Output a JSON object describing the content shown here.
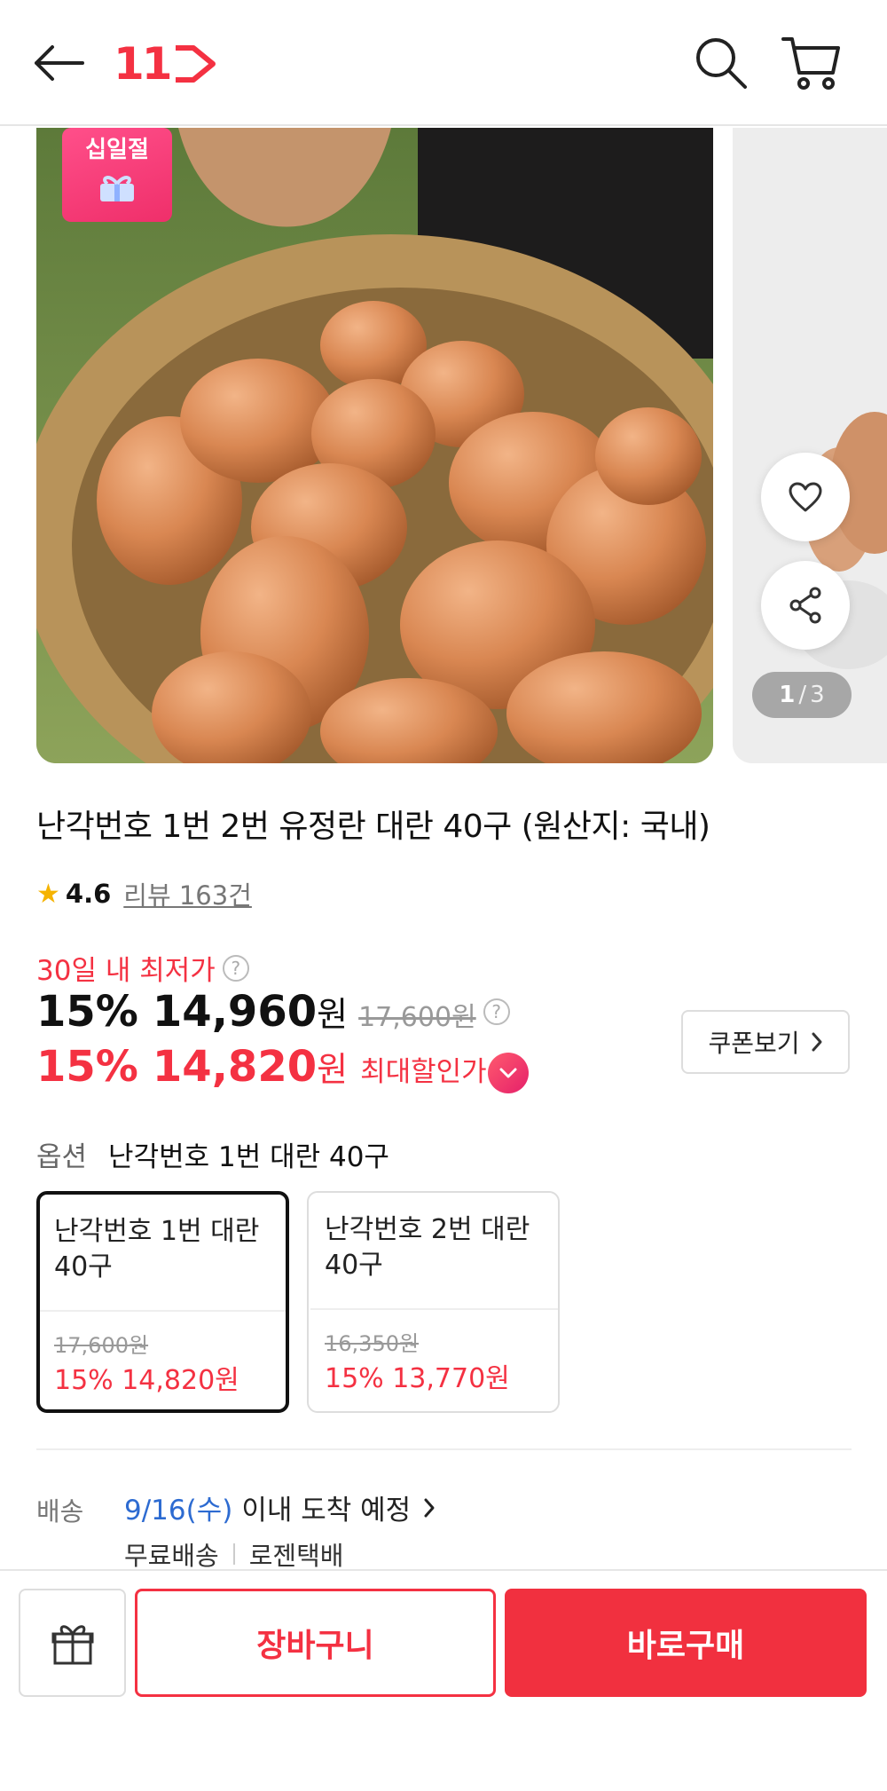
{
  "header": {
    "logo_text": "11",
    "icons": {
      "back": "arrow-left-icon",
      "search": "search-icon",
      "cart": "cart-icon"
    },
    "brand_color": "#f43142"
  },
  "gallery": {
    "event_badge": "십일절",
    "page_current": "1",
    "page_separator": "/",
    "page_total": "3",
    "icons": {
      "wish": "heart-icon",
      "share": "share-icon",
      "badge_gift": "gift-ribbon-icon"
    }
  },
  "product": {
    "title": "난각번호 1번 2번 유정란 대란 40구 (원산지: 국내)",
    "rating": "4.6",
    "review_text": "리뷰 163건"
  },
  "price": {
    "lowest_label": "30일 내 최저가",
    "discount_pct": "15%",
    "price": "14,960",
    "won": "원",
    "original_price": "17,600원",
    "max_discount_pct": "15%",
    "max_discount_price": "14,820",
    "max_discount_label": "최대할인가",
    "coupon_button": "쿠폰보기",
    "accent_color": "#f43142"
  },
  "option": {
    "label": "옵션",
    "selected_value": "난각번호 1번 대란 40구",
    "cards": [
      {
        "name": "난각번호 1번 대란 40구",
        "original": "17,600원",
        "discounted": "15% 14,820원",
        "selected": true
      },
      {
        "name": "난각번호 2번 대란 40구",
        "original": "16,350원",
        "discounted": "15% 13,770원",
        "selected": false
      }
    ]
  },
  "shipping": {
    "label": "배송",
    "date": "9/16(수)",
    "arrival_text": "이내 도착 예정",
    "fee": "무료배송",
    "carrier": "로젠택배",
    "date_color": "#2d6bd1"
  },
  "bottom": {
    "gift_icon": "gift-icon",
    "cart_button": "장바구니",
    "buy_button": "바로구매"
  }
}
